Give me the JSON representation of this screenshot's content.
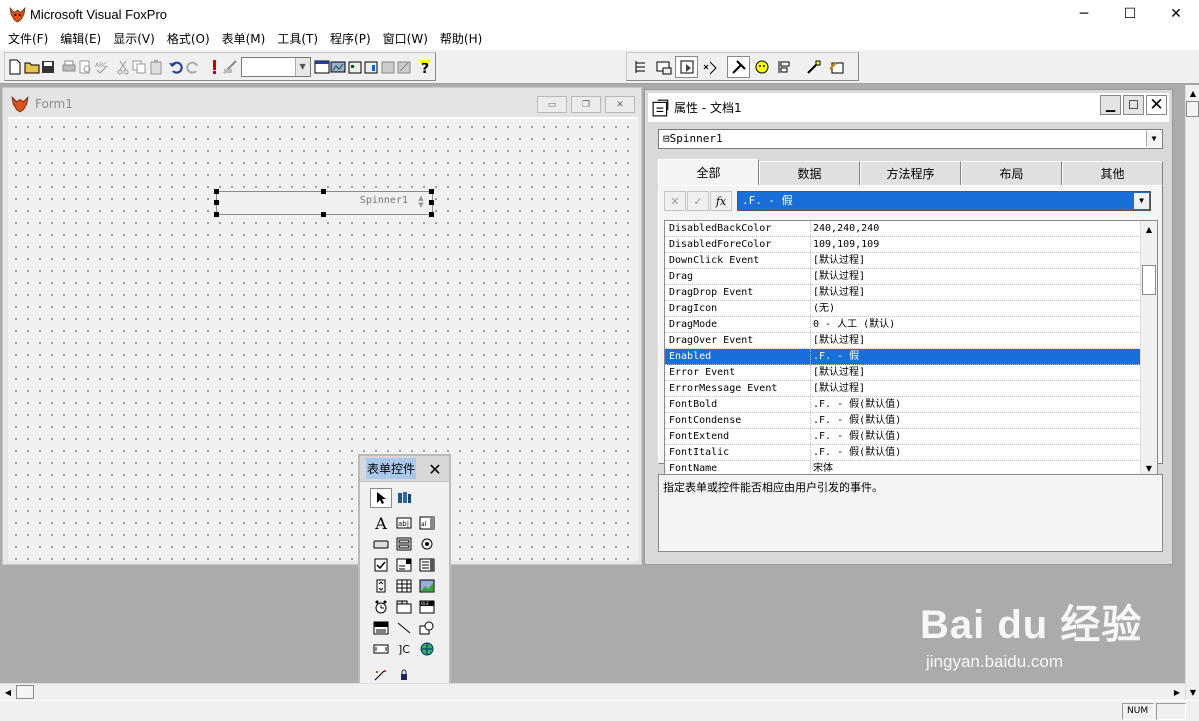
{
  "app": {
    "title": "Microsoft Visual FoxPro",
    "window_controls": {
      "minimize": "─",
      "maximize": "☐",
      "close": "✕"
    }
  },
  "menubar": [
    {
      "label": "文件(F)"
    },
    {
      "label": "编辑(E)"
    },
    {
      "label": "显示(V)"
    },
    {
      "label": "格式(O)"
    },
    {
      "label": "表单(M)"
    },
    {
      "label": "工具(T)"
    },
    {
      "label": "程序(P)"
    },
    {
      "label": "窗口(W)"
    },
    {
      "label": "帮助(H)"
    }
  ],
  "toolbar": {
    "combo_value": "",
    "combo_arrow": "▼"
  },
  "form_window": {
    "title": "Form1",
    "spinner_label": "Spinner1",
    "buttons": {
      "minimize": "▭",
      "restore": "❐",
      "close": "✕"
    }
  },
  "properties_window": {
    "title": "属性 - 文档1",
    "buttons": {
      "minimize": "▁",
      "maximize": "☐",
      "close": "✕"
    },
    "object_combo": "Spinner1",
    "object_icon": "⊟",
    "tabs": [
      {
        "label": "全部",
        "active": true
      },
      {
        "label": "数据"
      },
      {
        "label": "方法程序"
      },
      {
        "label": "布局"
      },
      {
        "label": "其他"
      }
    ],
    "edit_buttons": {
      "cancel": "✕",
      "accept": "✓",
      "fx": "fx"
    },
    "value_combo": ".F. - 假",
    "properties": [
      {
        "name": "DisabledBackColor",
        "value": "240,240,240"
      },
      {
        "name": "DisabledForeColor",
        "value": "109,109,109"
      },
      {
        "name": "DownClick Event",
        "value": "[默认过程]"
      },
      {
        "name": "Drag",
        "value": "[默认过程]"
      },
      {
        "name": "DragDrop Event",
        "value": "[默认过程]"
      },
      {
        "name": "DragIcon",
        "value": "(无)"
      },
      {
        "name": "DragMode",
        "value": "0 - 人工 (默认)"
      },
      {
        "name": "DragOver Event",
        "value": "[默认过程]"
      },
      {
        "name": "Enabled",
        "value": ".F. - 假",
        "selected": true
      },
      {
        "name": "Error Event",
        "value": "[默认过程]"
      },
      {
        "name": "ErrorMessage Event",
        "value": "[默认过程]"
      },
      {
        "name": "FontBold",
        "value": ".F. - 假(默认值)"
      },
      {
        "name": "FontCondense",
        "value": ".F. - 假(默认值)"
      },
      {
        "name": "FontExtend",
        "value": ".F. - 假(默认值)"
      },
      {
        "name": "FontItalic",
        "value": ".F. - 假(默认值)"
      },
      {
        "name": "FontName",
        "value": "宋体"
      }
    ],
    "description": "指定表单或控件能否相应由用户引发的事件。"
  },
  "toolbox": {
    "title": "表单控件",
    "close": "✕"
  },
  "statusbar": {
    "num": "NUM"
  },
  "watermark": {
    "logo": "Bai du 经验",
    "url": "jingyan.baidu.com"
  },
  "colors": {
    "selection": "#1a6ed8",
    "title_active": "#ffffff",
    "workspace": "#ababab"
  }
}
